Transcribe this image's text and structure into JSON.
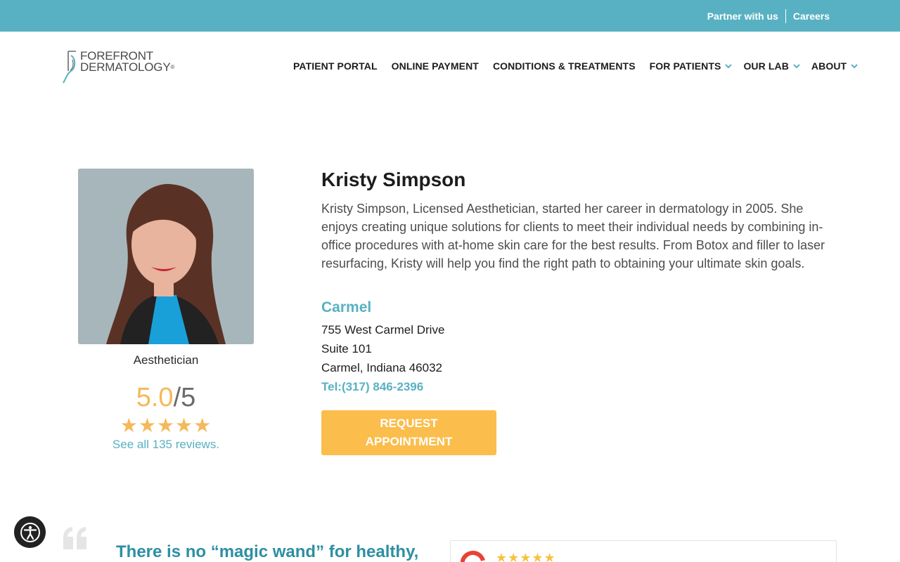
{
  "topbar": {
    "partner_label": "Partner with us",
    "careers_label": "Careers"
  },
  "brand": {
    "line1": "FOREFRONT",
    "line2": "DERMATOLOGY",
    "registered": "®",
    "accent_color": "#58b1c2"
  },
  "nav": {
    "items": [
      {
        "label": "PATIENT PORTAL",
        "has_dropdown": false
      },
      {
        "label": "ONLINE PAYMENT",
        "has_dropdown": false
      },
      {
        "label": "CONDITIONS & TREATMENTS",
        "has_dropdown": false
      },
      {
        "label": "FOR PATIENTS",
        "has_dropdown": true
      },
      {
        "label": "OUR LAB",
        "has_dropdown": true
      },
      {
        "label": "ABOUT",
        "has_dropdown": true
      }
    ]
  },
  "provider": {
    "name": "Kristy Simpson",
    "title": "Aesthetician",
    "bio": "Kristy Simpson, Licensed Aesthetician, started her career in dermatology in 2005. She enjoys creating unique solutions for clients to meet their individual needs by combining in-office procedures with at-home skin care for the best results. From Botox and filler to laser resurfacing, Kristy will help you find the right path to obtaining your ultimate skin goals.",
    "rating_score": "5.0",
    "rating_max": "/5",
    "stars": "★★★★★",
    "reviews_link": "See all 135 reviews."
  },
  "location": {
    "name": "Carmel",
    "address_line1": "755 West Carmel Drive",
    "address_line2": "Suite 101",
    "address_line3": "Carmel, Indiana 46032",
    "phone": "Tel:(317) 846-2396",
    "request_label": "REQUEST APPOINTMENT"
  },
  "testimonial": {
    "quote": "There is no “magic wand” for healthy,",
    "card_stars": "★★★★★"
  },
  "colors": {
    "accent": "#58b1c2",
    "rating": "#f6b85a",
    "button": "#fbbd4b",
    "quote_text": "#2d8fa3"
  }
}
